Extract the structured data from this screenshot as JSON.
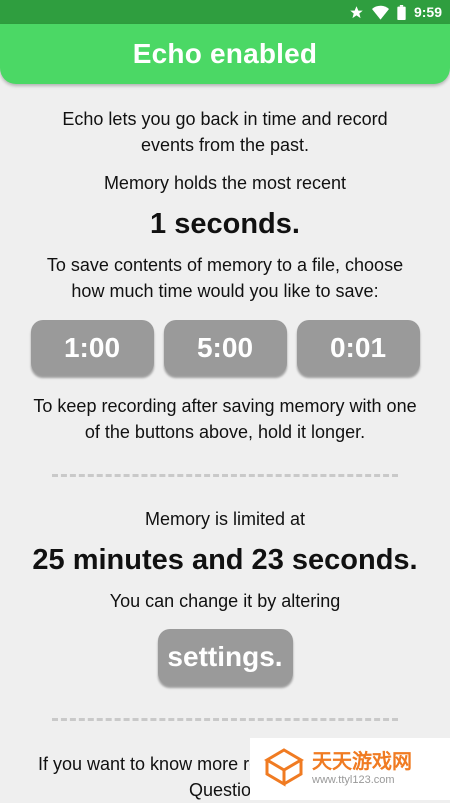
{
  "status_bar": {
    "time": "9:59",
    "icons": [
      "star-icon",
      "wifi-icon",
      "battery-icon"
    ]
  },
  "header": {
    "title": "Echo enabled",
    "color": "#4bd865"
  },
  "intro": "Echo lets you go back in time and record events from the past.",
  "memory_recent_label": "Memory holds the most recent",
  "memory_recent_value": "1 seconds.",
  "save_prompt": "To save contents of memory to a file, choose how much time would you like to save:",
  "save_buttons": [
    "1:00",
    "5:00",
    "0:01"
  ],
  "hold_hint": "To keep recording after saving memory with one of the buttons above, hold it longer.",
  "limit_label": "Memory is limited at",
  "limit_value": "25 minutes and 23 seconds.",
  "change_hint": "You can change it by altering",
  "settings_button": "settings.",
  "footer_line1": "If you want to know more re",
  "footer_line2": "Question",
  "watermark": {
    "main": "天天游戏网",
    "sub": "www.ttyl123.com"
  },
  "colors": {
    "button": "#9a9a9a",
    "background": "#efefef",
    "status_bar": "#2f9e3f"
  }
}
